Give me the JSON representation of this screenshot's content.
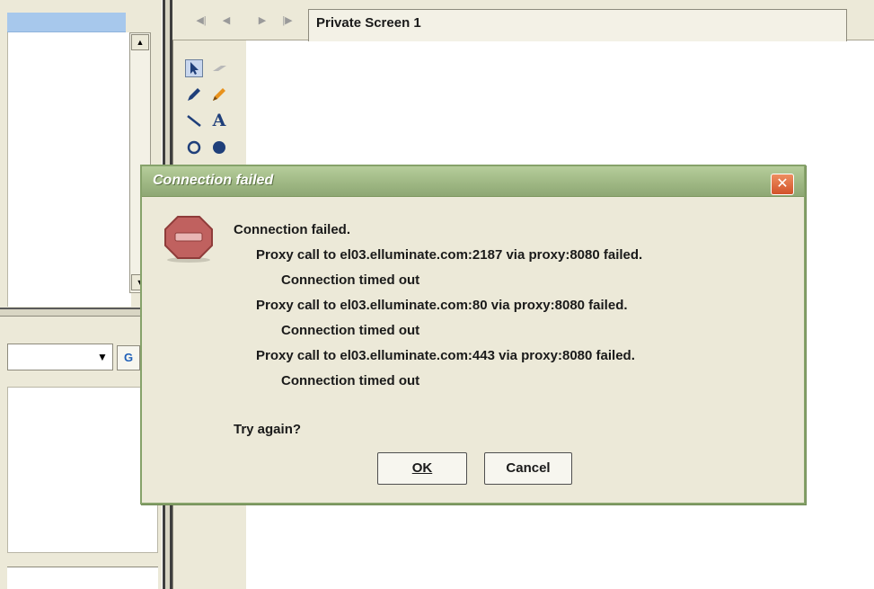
{
  "screen_tab": {
    "label": "Private Screen 1"
  },
  "dialog": {
    "title": "Connection failed",
    "heading": "Connection failed.",
    "details": [
      {
        "proxy_call": "Proxy call to el03.elluminate.com:2187 via proxy:8080 failed.",
        "reason": "Connection timed out"
      },
      {
        "proxy_call": "Proxy call to el03.elluminate.com:80 via proxy:8080 failed.",
        "reason": "Connection timed out"
      },
      {
        "proxy_call": "Proxy call to el03.elluminate.com:443 via proxy:8080 failed.",
        "reason": "Connection timed out"
      }
    ],
    "prompt": "Try again?",
    "ok_label": "OK",
    "cancel_label": "Cancel",
    "close_glyph": "✕"
  },
  "toolbox": {
    "tools": [
      "select-arrow-icon",
      "eraser-icon",
      "pen-icon",
      "highlighter-icon",
      "line-icon",
      "text-icon",
      "ellipse-icon",
      "filled-ellipse-icon"
    ],
    "text_tool_glyph": "A"
  },
  "icons": {
    "stop-icon": "stop sign",
    "nav": [
      "first-icon",
      "previous-icon",
      "next-icon",
      "last-icon"
    ]
  },
  "colors": {
    "dialog_title_bar": "#9db682",
    "close_button": "#d2522a",
    "stop_icon": "#c0615f",
    "selected_row": "#a7c8ec",
    "window_bg": "#ece9d8"
  }
}
